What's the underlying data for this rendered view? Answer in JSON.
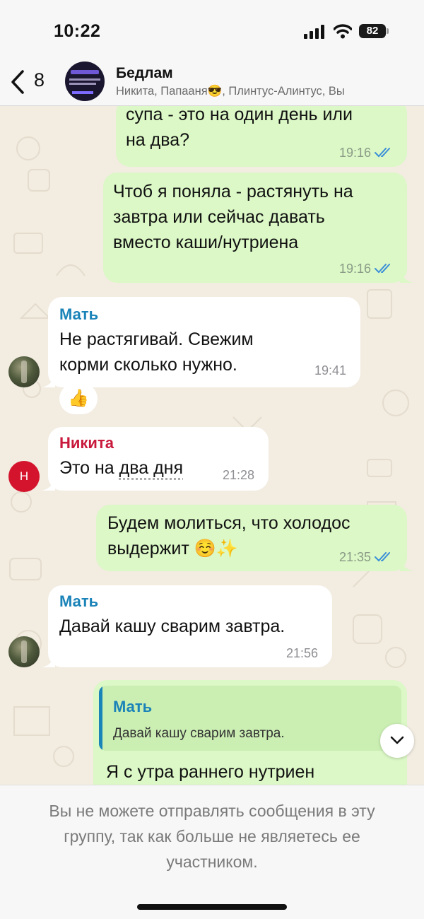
{
  "status_bar": {
    "time": "10:22",
    "battery": "82"
  },
  "header": {
    "back_count": "8",
    "title": "Бедлам",
    "members": "Никита, Папааня😎, Плинтус-Алинтус, Вы"
  },
  "messages": [
    {
      "direction": "out",
      "lines": [
        "супа - это на один день или",
        "на два?"
      ],
      "time": "19:16",
      "read": true
    },
    {
      "direction": "out",
      "lines": [
        "Чтоб я поняла - растянуть на",
        "завтра или сейчас давать",
        "вместо каши/нутриена"
      ],
      "time": "19:16",
      "read": true
    },
    {
      "direction": "in",
      "sender": "Мать",
      "lines": [
        "Не растягивай. Свежим",
        "корми сколько нужно."
      ],
      "time": "19:41",
      "reaction": "👍"
    },
    {
      "direction": "in",
      "sender": "Никита",
      "avatar_letter": "Н",
      "text_prefix": "Это на ",
      "text_underlined": "два дня",
      "time": "21:28"
    },
    {
      "direction": "out",
      "lines": [
        "Будем молиться, что холодос",
        "выдержит ☺️✨"
      ],
      "time": "21:35",
      "read": true
    },
    {
      "direction": "in",
      "sender": "Мать",
      "lines": [
        "Давай кашу сварим завтра."
      ],
      "time": "21:56"
    },
    {
      "direction": "out",
      "quote": {
        "sender": "Мать",
        "text": "Давай кашу сварим завтра."
      },
      "lines": [
        "Я с утра раннего нутриен"
      ]
    }
  ],
  "footer": {
    "notice": "Вы не можете отправлять сообщения в эту группу, так как больше не являетесь ее участником."
  },
  "colors": {
    "out_bubble": "#dbf8c6",
    "in_bubble": "#ffffff",
    "sender_mat": "#1a83b8",
    "sender_nikita": "#c8193c",
    "read_ticks": "#3b8ed8"
  }
}
